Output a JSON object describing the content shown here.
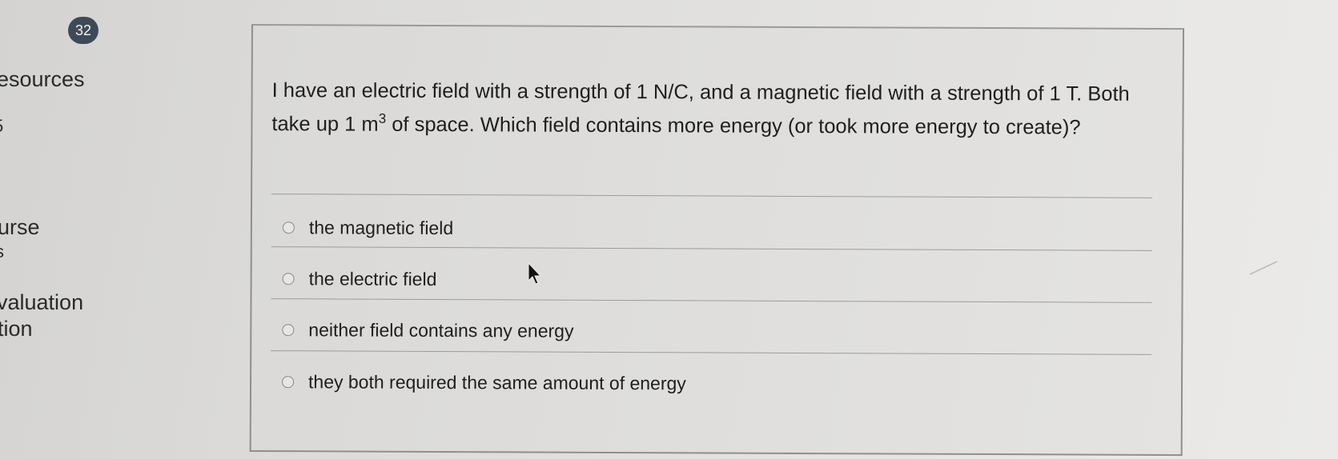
{
  "nav": {
    "badge": "32",
    "items": [
      {
        "label": "esources"
      },
      {
        "label": "urse"
      },
      {
        "label": "valuation"
      },
      {
        "label": "tion"
      }
    ],
    "fragments": [
      "5",
      "s"
    ]
  },
  "question": {
    "text_before_sup": "I have an electric field with a strength of 1 N/C, and a magnetic field with a strength of 1 T. Both take up 1 m",
    "superscript": "3",
    "text_after_sup": " of space.  Which field contains more energy (or took more energy to create)?",
    "options": [
      {
        "label": "the magnetic field"
      },
      {
        "label": "the electric field"
      },
      {
        "label": "neither field contains any energy"
      },
      {
        "label": "they both required the same amount of energy"
      }
    ]
  }
}
